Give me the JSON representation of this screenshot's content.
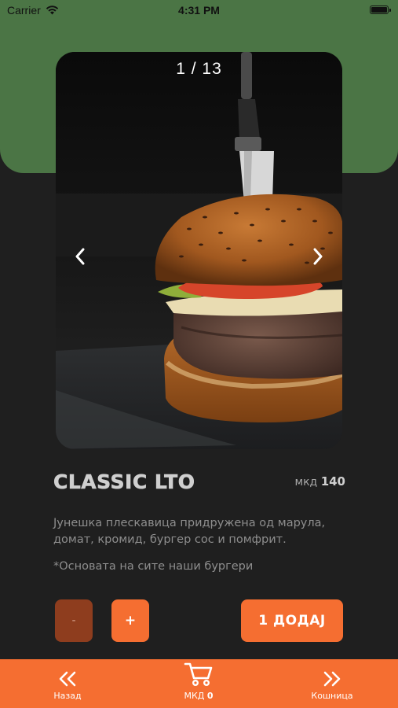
{
  "status_bar": {
    "carrier": "Carrier",
    "time": "4:31 PM"
  },
  "gallery": {
    "counter": "1 / 13",
    "prev_icon": "chevron-left-icon",
    "next_icon": "chevron-right-icon",
    "image_subject": "burger-photo"
  },
  "product": {
    "title": "CLASSIC LTO",
    "currency": "мкд",
    "price": "140",
    "description": "Јунешка плескавица придружена од марула, домат, кромид, бургер сос и помфрит.",
    "note": "*Основата на сите наши бургери"
  },
  "actions": {
    "minus_label": "-",
    "plus_label": "+",
    "add_label": "1 ДОДАЈ"
  },
  "bottom_nav": {
    "back_label": "Назад",
    "back_icon": "double-chevron-left-icon",
    "cart_currency": "МКД",
    "cart_total": "0",
    "cart_icon": "cart-icon",
    "basket_label": "Кошница",
    "basket_icon": "double-chevron-right-icon"
  },
  "colors": {
    "header_green": "#4b7545",
    "background": "#1f1f1f",
    "accent_orange": "#f56e31",
    "minus_brown": "#8e3d1e",
    "text_light": "#cfcfcf",
    "text_muted": "#8e8e8e"
  }
}
